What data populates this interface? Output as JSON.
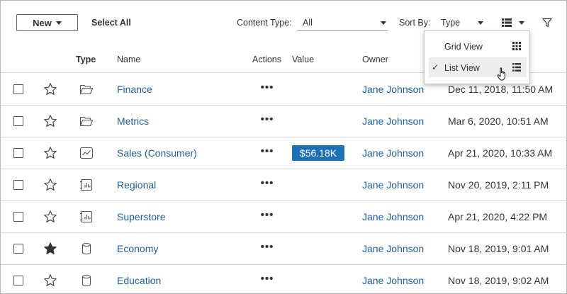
{
  "toolbar": {
    "new_label": "New",
    "select_all_label": "Select All",
    "content_type_label": "Content Type:",
    "content_type_value": "All",
    "sort_by_label": "Sort By:",
    "sort_by_value": "Type"
  },
  "view_menu": {
    "items": [
      {
        "label": "Grid View",
        "selected": false,
        "icon": "grid-icon"
      },
      {
        "label": "List View",
        "selected": true,
        "icon": "list-icon"
      }
    ],
    "check_mark": "✓"
  },
  "columns": {
    "type": "Type",
    "name": "Name",
    "actions": "Actions",
    "value": "Value",
    "owner": "Owner"
  },
  "rows": [
    {
      "favorite": false,
      "type_icon": "folder-icon",
      "name": "Finance",
      "actions": "•••",
      "value": "",
      "owner": "Jane Johnson",
      "modified": "Dec 11, 2018, 11:50 AM"
    },
    {
      "favorite": false,
      "type_icon": "folder-icon",
      "name": "Metrics",
      "actions": "•••",
      "value": "",
      "owner": "Jane Johnson",
      "modified": "Mar 6, 2020, 10:51 AM"
    },
    {
      "favorite": false,
      "type_icon": "metric-icon",
      "name": "Sales (Consumer)",
      "actions": "•••",
      "value": "$56.18K",
      "owner": "Jane Johnson",
      "modified": "Apr 21, 2020, 10:33 AM"
    },
    {
      "favorite": false,
      "type_icon": "workbook-icon",
      "name": "Regional",
      "actions": "•••",
      "value": "",
      "owner": "Jane Johnson",
      "modified": "Nov 20, 2019, 2:11 PM"
    },
    {
      "favorite": false,
      "type_icon": "workbook-icon",
      "name": "Superstore",
      "actions": "•••",
      "value": "",
      "owner": "Jane Johnson",
      "modified": "Apr 21, 2020, 4:22 PM"
    },
    {
      "favorite": true,
      "type_icon": "datasource-icon",
      "name": "Economy",
      "actions": "•••",
      "value": "",
      "owner": "Jane Johnson",
      "modified": "Nov 18, 2019, 9:01 AM"
    },
    {
      "favorite": false,
      "type_icon": "datasource-icon",
      "name": "Education",
      "actions": "•••",
      "value": "",
      "owner": "Jane Johnson",
      "modified": "Nov 18, 2019, 9:02 AM"
    }
  ],
  "colors": {
    "link": "#1f5f99",
    "value_badge": "#1f6fb3"
  }
}
